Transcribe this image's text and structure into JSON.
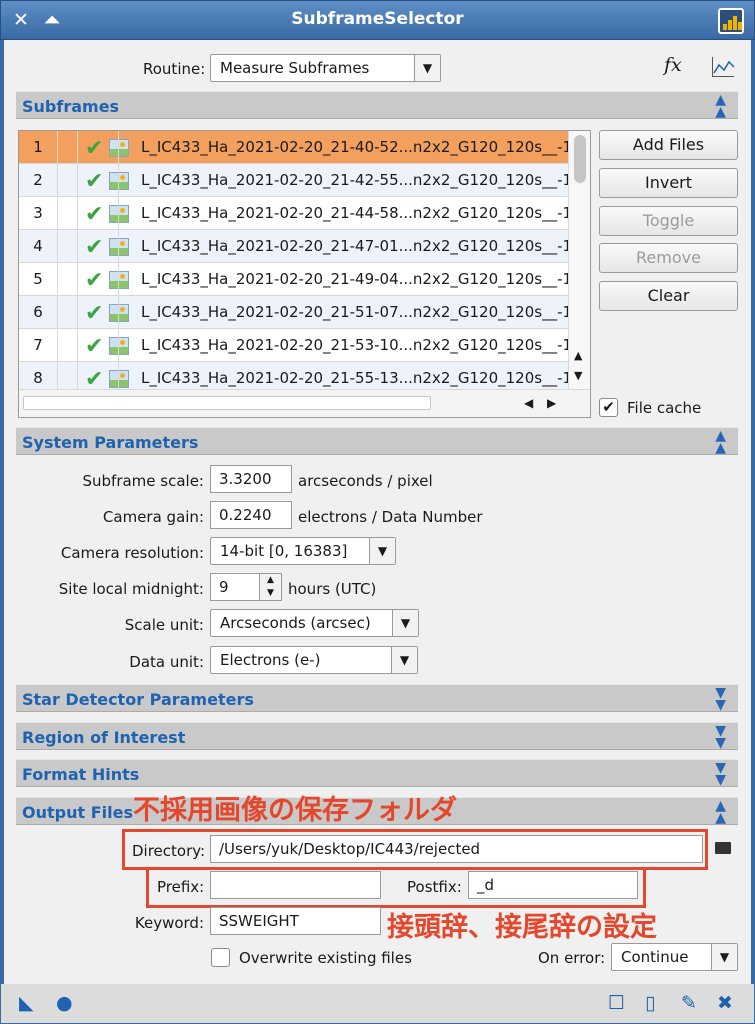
{
  "window": {
    "title": "SubframeSelector"
  },
  "routine": {
    "label": "Routine:",
    "value": "Measure Subframes",
    "fx_label": "fx"
  },
  "sections": {
    "subframes": "Subframes",
    "system": "System Parameters",
    "star": "Star Detector Parameters",
    "roi": "Region of Interest",
    "format": "Format Hints",
    "output": "Output Files"
  },
  "subframes": {
    "rows": [
      {
        "num": "1",
        "check": "✔",
        "file": "L_IC433_Ha_2021-02-20_21-40-52...n2x2_G120_120s__-1"
      },
      {
        "num": "2",
        "check": "✔",
        "file": "L_IC433_Ha_2021-02-20_21-42-55...n2x2_G120_120s__-1"
      },
      {
        "num": "3",
        "check": "✔",
        "file": "L_IC433_Ha_2021-02-20_21-44-58...n2x2_G120_120s__-1"
      },
      {
        "num": "4",
        "check": "✔",
        "file": "L_IC433_Ha_2021-02-20_21-47-01...n2x2_G120_120s__-1"
      },
      {
        "num": "5",
        "check": "✔",
        "file": "L_IC433_Ha_2021-02-20_21-49-04...n2x2_G120_120s__-1"
      },
      {
        "num": "6",
        "check": "✔",
        "file": "L_IC433_Ha_2021-02-20_21-51-07...n2x2_G120_120s__-1"
      },
      {
        "num": "7",
        "check": "✔",
        "file": "L_IC433_Ha_2021-02-20_21-53-10...n2x2_G120_120s__-1"
      },
      {
        "num": "8",
        "check": "✔",
        "file": "L_IC433_Ha_2021-02-20_21-55-13...n2x2_G120_120s__-1"
      }
    ],
    "buttons": {
      "add": "Add Files",
      "invert": "Invert",
      "toggle": "Toggle",
      "remove": "Remove",
      "clear": "Clear"
    },
    "file_cache": {
      "label": "File cache",
      "checked": true
    }
  },
  "system": {
    "scale_label": "Subframe scale:",
    "scale_value": "3.3200",
    "scale_unit": "arcseconds / pixel",
    "gain_label": "Camera gain:",
    "gain_value": "0.2240",
    "gain_unit": "electrons / Data Number",
    "res_label": "Camera resolution:",
    "res_value": "14-bit [0, 16383]",
    "midnight_label": "Site local midnight:",
    "midnight_value": "9",
    "midnight_unit": "hours (UTC)",
    "scale_unit_label": "Scale unit:",
    "scale_unit_value": "Arcseconds (arcsec)",
    "data_unit_label": "Data unit:",
    "data_unit_value": "Electrons (e-)"
  },
  "output": {
    "directory_label": "Directory:",
    "directory_value": "/Users/yuk/Desktop/IC443/rejected",
    "prefix_label": "Prefix:",
    "prefix_value": "",
    "postfix_label": "Postfix:",
    "postfix_value": "_d",
    "keyword_label": "Keyword:",
    "keyword_value": "SSWEIGHT",
    "overwrite_label": "Overwrite existing files",
    "overwrite_checked": false,
    "onerror_label": "On error:",
    "onerror_value": "Continue"
  },
  "annotations": {
    "top": "不採用画像の保存フォルダ",
    "bottom": "接頭辞、接尾辞の設定"
  },
  "colors": {
    "accent": "#1f63b0",
    "selected_row": "#f3a05f",
    "annotation": "#e4472c",
    "check": "#3ca441"
  }
}
